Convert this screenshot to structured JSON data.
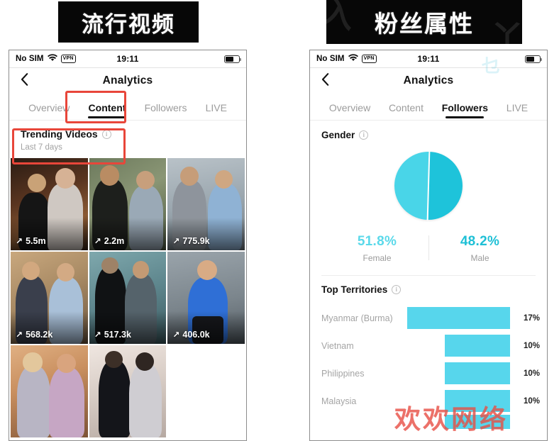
{
  "banners": {
    "left_caption": "流行视频",
    "right_caption": "粉丝属性"
  },
  "watermark": "欢欢网络",
  "colors": {
    "annotation_red": "#E8463A",
    "pie_female": "#49D5E8",
    "pie_male": "#1EC3DA",
    "bar_cyan": "#57D6EC",
    "tab_active": "#121212",
    "tab_inactive": "#9C9C9C",
    "muted_text": "#A4A4A4"
  },
  "left_phone": {
    "status_bar": {
      "carrier": "No SIM",
      "wifi_icon": "wifi-icon",
      "vpn_badge": "VPN",
      "time": "19:11",
      "battery_icon": "battery-icon"
    },
    "nav": {
      "back_icon": "chevron-left-icon",
      "title": "Analytics"
    },
    "tabs": [
      {
        "label": "Overview",
        "active": false
      },
      {
        "label": "Content",
        "active": true
      },
      {
        "label": "Followers",
        "active": false
      },
      {
        "label": "LIVE",
        "active": false
      }
    ],
    "section": {
      "title": "Trending Videos",
      "info_icon": "info-icon",
      "subtitle": "Last 7 days"
    },
    "videos": [
      {
        "views": "5.5m",
        "arrow_icon": "arrow-up-right-icon"
      },
      {
        "views": "2.2m",
        "arrow_icon": "arrow-up-right-icon"
      },
      {
        "views": "775.9k",
        "arrow_icon": "arrow-up-right-icon"
      },
      {
        "views": "568.2k",
        "arrow_icon": "arrow-up-right-icon"
      },
      {
        "views": "517.3k",
        "arrow_icon": "arrow-up-right-icon"
      },
      {
        "views": "406.0k",
        "arrow_icon": "arrow-up-right-icon"
      },
      {
        "views": "",
        "arrow_icon": ""
      },
      {
        "views": "",
        "arrow_icon": ""
      }
    ]
  },
  "right_phone": {
    "status_bar": {
      "carrier": "No SIM",
      "wifi_icon": "wifi-icon",
      "vpn_badge": "VPN",
      "time": "19:11",
      "battery_icon": "battery-icon"
    },
    "nav": {
      "back_icon": "chevron-left-icon",
      "title": "Analytics"
    },
    "tabs": [
      {
        "label": "Overview",
        "active": false
      },
      {
        "label": "Content",
        "active": false
      },
      {
        "label": "Followers",
        "active": true
      },
      {
        "label": "LIVE",
        "active": false
      }
    ],
    "gender": {
      "title": "Gender",
      "info_icon": "info-icon",
      "female_pct": "51.8%",
      "female_label": "Female",
      "male_pct": "48.2%",
      "male_label": "Male"
    },
    "territories": {
      "title": "Top Territories",
      "info_icon": "info-icon"
    }
  },
  "chart_data": [
    {
      "type": "pie",
      "title": "Gender",
      "labels": [
        "Female",
        "Male"
      ],
      "values": [
        51.8,
        48.2
      ],
      "value_labels": [
        "51.8%",
        "48.2%"
      ],
      "colors": [
        "#49D5E8",
        "#1EC3DA"
      ],
      "legend": "below"
    },
    {
      "type": "bar",
      "title": "Top Territories",
      "orientation": "horizontal",
      "categories": [
        "Myanmar (Burma)",
        "Vietnam",
        "Philippines",
        "Malaysia"
      ],
      "values": [
        17,
        10,
        10,
        10
      ],
      "value_labels": [
        "17%",
        "10%",
        "10%",
        "10%"
      ],
      "xlabel": "",
      "ylabel": "",
      "xlim": [
        0,
        17
      ],
      "grid": false,
      "bar_color": "#57D6EC",
      "note": "bars right-aligned; a fifth bar is clipped at the bottom edge of the viewport"
    }
  ]
}
